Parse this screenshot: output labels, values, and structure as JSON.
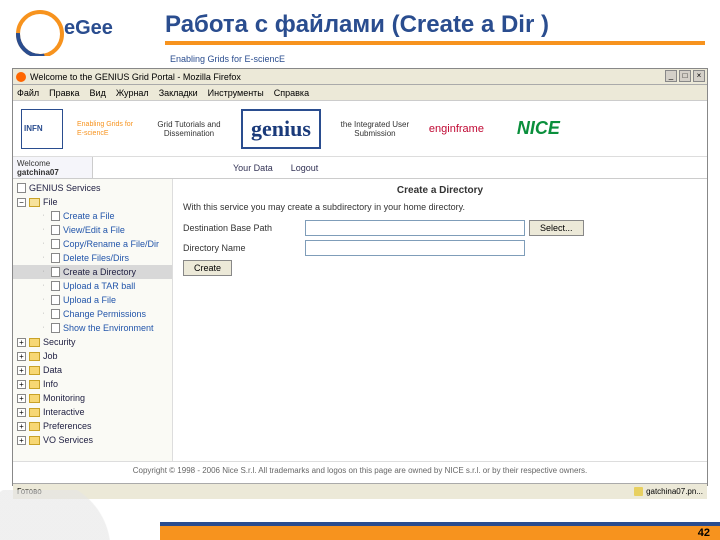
{
  "slide": {
    "title": "Работа с файлами (Create a Dir )",
    "subtitle": "Enabling Grids for E-sciencE",
    "page_number": "42"
  },
  "browser": {
    "window_title": "Welcome to the GENIUS Grid Portal - Mozilla Firefox",
    "menus": [
      "Файл",
      "Правка",
      "Вид",
      "Журнал",
      "Закладки",
      "Инструменты",
      "Справка"
    ],
    "window_controls": {
      "min": "_",
      "max": "□",
      "close": "×"
    }
  },
  "logos": {
    "infn": "INFN",
    "egee2": "Enabling Grids for E-sciencE",
    "gridtut": "Grid Tutorials and Dissemination",
    "genius": "genius",
    "integ": "the Integrated User Submission",
    "engin": "enginframe",
    "nice": "NICE"
  },
  "tabs": {
    "welcome_label": "Welcome",
    "welcome_user": "gatchina07",
    "items": [
      "Your Data",
      "Logout"
    ]
  },
  "sidebar": {
    "root": "GENIUS Services",
    "file_node": "File",
    "file_children": [
      "Create a File",
      "View/Edit a File",
      "Copy/Rename a File/Dir",
      "Delete Files/Dirs",
      "Create a Directory",
      "Upload a TAR ball",
      "Upload a File",
      "Change Permissions",
      "Show the Environment"
    ],
    "selected": "Create a Directory",
    "others": [
      "Security",
      "Job",
      "Data",
      "Info",
      "Monitoring",
      "Interactive",
      "Preferences",
      "VO Services"
    ]
  },
  "content": {
    "heading": "Create a Directory",
    "desc": "With this service you may create a subdirectory in your home directory.",
    "field1_label": "Destination Base Path",
    "field1_value": "",
    "select_button": "Select...",
    "field2_label": "Directory Name",
    "field2_value": "",
    "create_button": "Create"
  },
  "footer": {
    "copyright": "Copyright © 1998 - 2006 Nice S.r.l. All trademarks and logos on this page are owned by NICE s.r.l. or by their respective owners."
  },
  "statusbar": {
    "label": "Готово",
    "security": "gatchina07.pn..."
  }
}
